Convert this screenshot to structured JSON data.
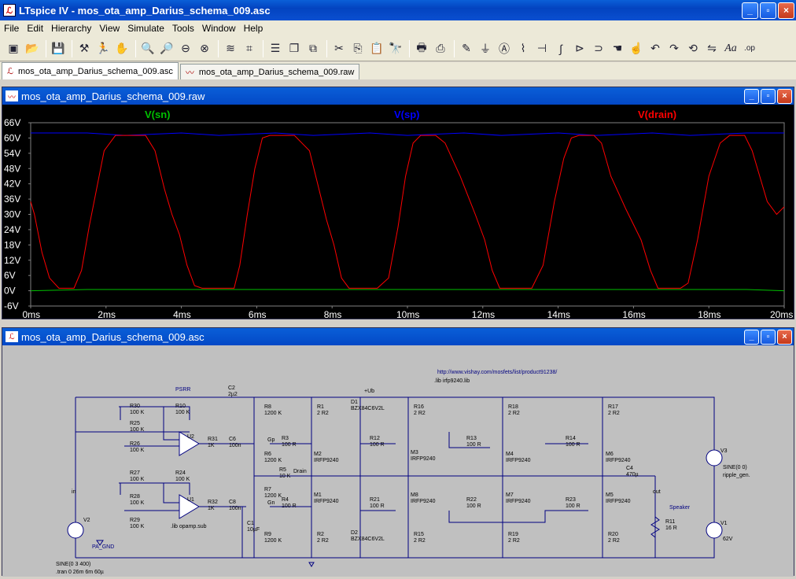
{
  "app": {
    "title": "LTspice IV - mos_ota_amp_Darius_schema_009.asc",
    "icon": "ltspice-app-icon"
  },
  "window_buttons": {
    "minimize": "_",
    "maximize": "▫",
    "close": "×"
  },
  "menu": [
    "File",
    "Edit",
    "Hierarchy",
    "View",
    "Simulate",
    "Tools",
    "Window",
    "Help"
  ],
  "toolbar_icons": [
    "new-schematic-icon",
    "open-icon",
    "save-icon",
    "control-panel-icon",
    "run-icon",
    "halt-icon",
    "zoom-in-icon",
    "zoom-pan-icon",
    "zoom-out-icon",
    "zoom-fit-icon",
    "autorange-icon",
    "mark-icon",
    "tile-horizontal-icon",
    "cascade-icon",
    "tile-icon",
    "cut-icon",
    "copy-icon",
    "paste-icon",
    "find-icon",
    "print-setup-icon",
    "print-icon",
    "draw-wire-icon",
    "ground-icon",
    "label-net-icon",
    "resistor-icon",
    "capacitor-icon",
    "inductor-icon",
    "diode-icon",
    "component-icon",
    "move-icon",
    "drag-icon",
    "undo-icon",
    "redo-icon",
    "rotate-icon",
    "mirror-icon",
    "text-icon",
    "spice-directive-icon"
  ],
  "tabs": [
    {
      "label": "mos_ota_amp_Darius_schema_009.asc",
      "icon": "schematic-tab-icon",
      "active": true
    },
    {
      "label": "mos_ota_amp_Darius_schema_009.raw",
      "icon": "waveform-tab-icon",
      "active": false
    }
  ],
  "waveform_window": {
    "title": "mos_ota_amp_Darius_schema_009.raw",
    "traces": [
      {
        "name": "V(sn)",
        "color": "#00c000"
      },
      {
        "name": "V(sp)",
        "color": "#0000ff"
      },
      {
        "name": "V(drain)",
        "color": "#ff0000"
      }
    ]
  },
  "chart_data": {
    "type": "line",
    "y_ticks": [
      "66V",
      "60V",
      "54V",
      "48V",
      "42V",
      "36V",
      "30V",
      "24V",
      "18V",
      "12V",
      "6V",
      "0V",
      "-6V"
    ],
    "x_ticks": [
      "0ms",
      "2ms",
      "4ms",
      "6ms",
      "8ms",
      "10ms",
      "12ms",
      "14ms",
      "16ms",
      "18ms",
      "20ms"
    ],
    "ylim": [
      -6,
      66
    ],
    "xlim": [
      0,
      20
    ],
    "grid": false,
    "series": [
      {
        "name": "V(sn)",
        "x": [
          0,
          1.5,
          2.5,
          4,
          5,
          6.5,
          7.5,
          9,
          10,
          11.5,
          12.5,
          14,
          15,
          16.5,
          17.5,
          19,
          20
        ],
        "y": [
          0,
          0.5,
          0.5,
          0.5,
          0.5,
          0.5,
          0.5,
          0.5,
          0.5,
          0.5,
          0.5,
          0.5,
          0.5,
          0.5,
          0.5,
          0.5,
          0
        ]
      },
      {
        "name": "V(sp)",
        "x": [
          0,
          1.5,
          2.5,
          4,
          5,
          6.5,
          7.5,
          9,
          10,
          11.5,
          12.5,
          14,
          15,
          16.5,
          17.5,
          19,
          20
        ],
        "y": [
          62,
          62,
          61,
          62,
          61,
          62,
          61,
          62,
          61,
          62,
          61,
          62,
          61,
          62,
          61,
          62,
          62
        ]
      },
      {
        "name": "V(drain)",
        "x": [
          0,
          0.1,
          0.3,
          0.5,
          0.75,
          0.95,
          1.15,
          1.35,
          1.55,
          1.75,
          1.95,
          2.25,
          2.65,
          3.05,
          3.3,
          3.55,
          3.75,
          3.95,
          4.15,
          4.35,
          4.55,
          4.85,
          5.15,
          5.4,
          5.55,
          5.75,
          5.95,
          6.15,
          6.35,
          6.6,
          7.0,
          7.4,
          7.65,
          7.85,
          8.05,
          8.25,
          8.45,
          8.65,
          8.9,
          9.2,
          9.5,
          9.75,
          9.95,
          10.15,
          10.35,
          10.55,
          10.75,
          11.0,
          11.4,
          11.8,
          12.05,
          12.25,
          12.45,
          12.65,
          12.85,
          13.05,
          13.3,
          13.6,
          13.9,
          14.15,
          14.35,
          14.55,
          14.75,
          14.95,
          15.15,
          15.4,
          15.8,
          16.2,
          16.45,
          16.65,
          16.85,
          17.05,
          17.25,
          17.45,
          17.7,
          18.0,
          18.3,
          18.55,
          18.75,
          18.95,
          19.15,
          19.35,
          19.55,
          19.8,
          20
        ],
        "y": [
          35,
          30,
          15,
          5,
          1,
          1,
          1,
          8,
          25,
          40,
          55,
          61,
          61,
          61,
          55,
          40,
          30,
          22,
          10,
          2,
          1,
          1,
          1,
          1,
          10,
          30,
          48,
          60,
          61,
          61,
          61,
          55,
          40,
          28,
          18,
          5,
          1,
          1,
          1,
          1,
          5,
          25,
          45,
          58,
          61,
          61,
          61,
          58,
          45,
          30,
          20,
          8,
          1,
          1,
          1,
          1,
          1,
          10,
          35,
          52,
          60,
          61,
          61,
          61,
          58,
          45,
          32,
          20,
          8,
          1,
          1,
          1,
          1,
          3,
          20,
          45,
          58,
          61,
          61,
          61,
          55,
          45,
          35,
          30,
          33
        ]
      }
    ]
  },
  "schematic_window": {
    "title": "mos_ota_amp_Darius_schema_009.asc",
    "labels": {
      "url": "http://www.vishay.com/mosfets/list/product91238/",
      "lib_irfp": ".lib irfp9240.lib",
      "lib_opamp": ".lib opamp.sub",
      "psrr": "PSRR",
      "ub": "+Ub",
      "drain": "Drain",
      "gp": "Gp",
      "gn": "Gn",
      "in": "in",
      "out": "out",
      "speaker": "Speaker",
      "pa_gnd": "PA_GND",
      "sine_v2": "SINE(0 3 400)",
      "tran": ".tran 0 26m 6m 60µ",
      "sine_v3": "SINE(0 0)",
      "ripple": "ripple_gen.",
      "v1_val": "62V"
    },
    "parts": [
      {
        "ref": "R30",
        "val": "100 K"
      },
      {
        "ref": "R10",
        "val": "100 K"
      },
      {
        "ref": "R25",
        "val": "100 K"
      },
      {
        "ref": "R26",
        "val": "100 K"
      },
      {
        "ref": "R27",
        "val": "100 K"
      },
      {
        "ref": "R24",
        "val": "100 K"
      },
      {
        "ref": "R28",
        "val": "100 K"
      },
      {
        "ref": "R29",
        "val": "100 K"
      },
      {
        "ref": "U2",
        "val": ""
      },
      {
        "ref": "U1",
        "val": ""
      },
      {
        "ref": "R31",
        "val": "1K"
      },
      {
        "ref": "R32",
        "val": "1K"
      },
      {
        "ref": "C6",
        "val": "100n"
      },
      {
        "ref": "C8",
        "val": "100n"
      },
      {
        "ref": "C2",
        "val": "2µ2"
      },
      {
        "ref": "C1",
        "val": "10µF"
      },
      {
        "ref": "R8",
        "val": "1200 K"
      },
      {
        "ref": "R6",
        "val": "1200 K"
      },
      {
        "ref": "R7",
        "val": "1200 K"
      },
      {
        "ref": "R9",
        "val": "1200 K"
      },
      {
        "ref": "R3",
        "val": "100 R"
      },
      {
        "ref": "R4",
        "val": "100 R"
      },
      {
        "ref": "R5",
        "val": "10 K"
      },
      {
        "ref": "R1",
        "val": "2 R2"
      },
      {
        "ref": "R2",
        "val": "2 R2"
      },
      {
        "ref": "M2",
        "val": "IRFP9240"
      },
      {
        "ref": "M1",
        "val": "IRFP9240"
      },
      {
        "ref": "D1",
        "val": "BZX84C6V2L"
      },
      {
        "ref": "D2",
        "val": "BZX84C6V2L"
      },
      {
        "ref": "R12",
        "val": "100 R"
      },
      {
        "ref": "R21",
        "val": "100 R"
      },
      {
        "ref": "R16",
        "val": "2 R2"
      },
      {
        "ref": "R15",
        "val": "2 R2"
      },
      {
        "ref": "M3",
        "val": "IRFP9240"
      },
      {
        "ref": "M8",
        "val": "IRFP9240"
      },
      {
        "ref": "R13",
        "val": "100 R"
      },
      {
        "ref": "R22",
        "val": "100 R"
      },
      {
        "ref": "R18",
        "val": "2 R2"
      },
      {
        "ref": "R19",
        "val": "2 R2"
      },
      {
        "ref": "M4",
        "val": "IRFP9240"
      },
      {
        "ref": "M7",
        "val": "IRFP9240"
      },
      {
        "ref": "R14",
        "val": "100 R"
      },
      {
        "ref": "R23",
        "val": "100 R"
      },
      {
        "ref": "R17",
        "val": "2 R2"
      },
      {
        "ref": "R20",
        "val": "2 R2"
      },
      {
        "ref": "M6",
        "val": "IRFP9240"
      },
      {
        "ref": "M5",
        "val": "IRFP9240"
      },
      {
        "ref": "C4",
        "val": "470µ"
      },
      {
        "ref": "R11",
        "val": "16 R"
      },
      {
        "ref": "V2",
        "val": ""
      },
      {
        "ref": "V3",
        "val": ""
      },
      {
        "ref": "V1",
        "val": ""
      }
    ]
  }
}
